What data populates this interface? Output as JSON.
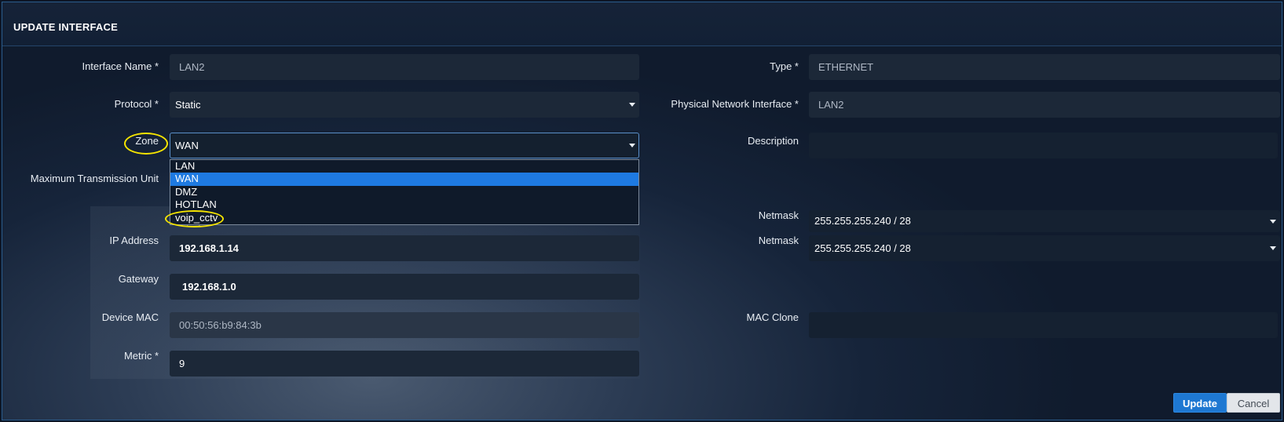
{
  "header": {
    "title": "UPDATE INTERFACE"
  },
  "form": {
    "interface_name": {
      "label": "Interface Name *",
      "value": "LAN2"
    },
    "type": {
      "label": "Type *",
      "value": "ETHERNET"
    },
    "protocol": {
      "label": "Protocol *",
      "value": "Static"
    },
    "physical_interface": {
      "label": "Physical Network Interface *",
      "value": "LAN2"
    },
    "zone": {
      "label": "Zone",
      "value": "WAN",
      "options": [
        "LAN",
        "WAN",
        "DMZ",
        "HOTLAN",
        "voip_cctv"
      ],
      "selected_option": "WAN"
    },
    "description": {
      "label": "Description",
      "value": ""
    },
    "mtu": {
      "label": "Maximum Transmission Unit"
    },
    "netmask_1": {
      "label": "Netmask",
      "value": "255.255.255.240 / 28"
    },
    "ip_address": {
      "label": "IP Address",
      "value": "192.168.1.14"
    },
    "netmask_2": {
      "label": "Netmask",
      "value": "255.255.255.240 / 28"
    },
    "gateway": {
      "label": "Gateway",
      "value": "192.168.1.0"
    },
    "device_mac": {
      "label": "Device MAC",
      "value": "00:50:56:b9:84:3b"
    },
    "mac_clone": {
      "label": "MAC Clone",
      "value": ""
    },
    "metric": {
      "label": "Metric *",
      "value": "9"
    }
  },
  "buttons": {
    "update": "Update",
    "cancel": "Cancel"
  },
  "colors": {
    "accent": "#1e78d2",
    "highlight": "#f5e400",
    "dropdown_active": "#1e7ae2"
  }
}
